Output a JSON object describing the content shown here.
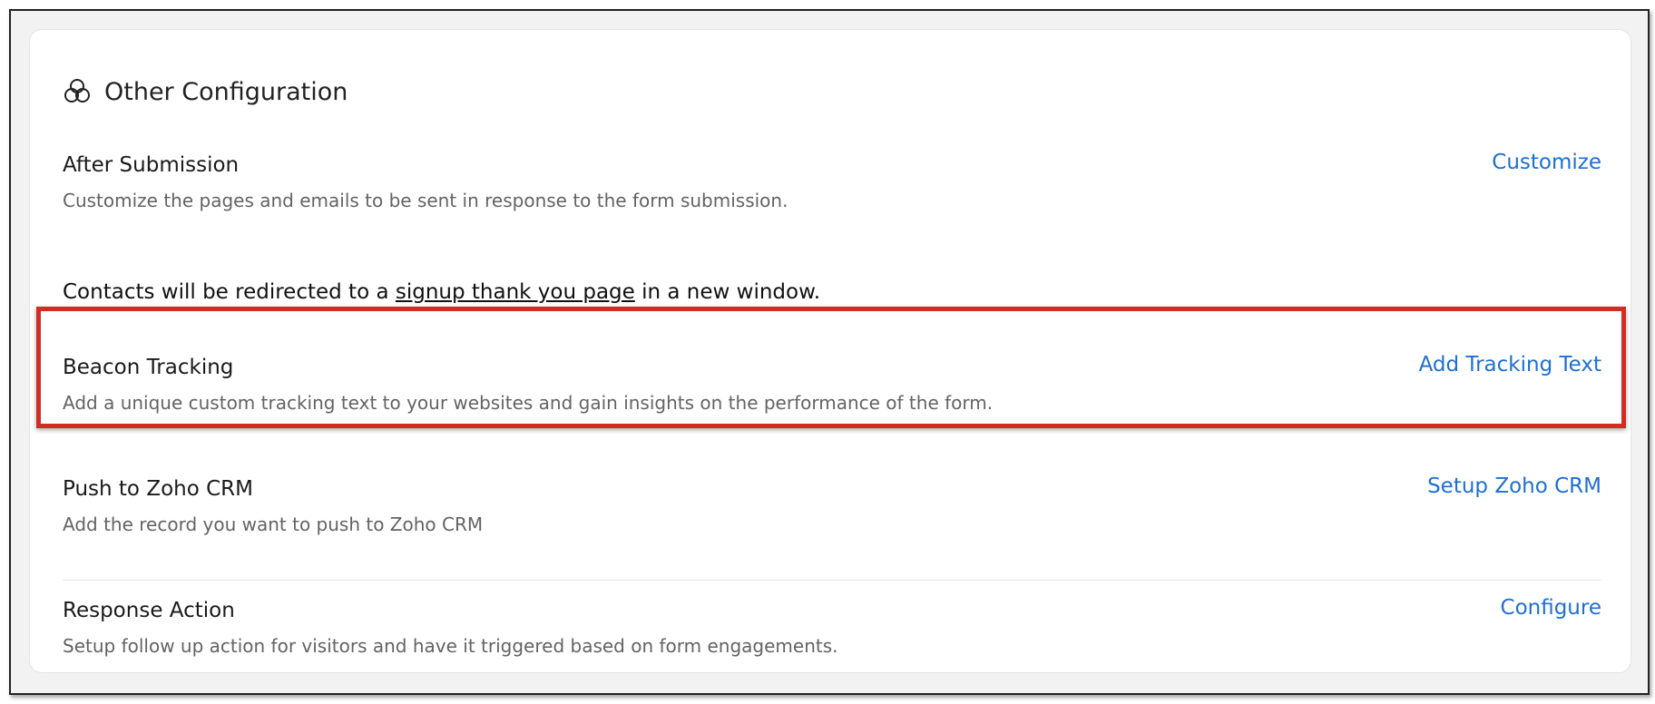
{
  "card": {
    "title": "Other Configuration",
    "icon": "circles-icon"
  },
  "sections": [
    {
      "title": "After Submission",
      "description": "Customize the pages and emails to be sent in response to the form submission.",
      "link": "Customize"
    },
    {
      "title": "Beacon Tracking",
      "description": "Add a unique custom tracking text to your websites and gain insights on the performance of the form.",
      "link": "Add Tracking Text"
    },
    {
      "title": "Push to Zoho CRM",
      "description": "Add the record you want to push to Zoho CRM",
      "link": "Setup Zoho CRM"
    },
    {
      "title": "Response Action",
      "description": "Setup follow up action for visitors and have it triggered based on form engagements.",
      "link": "Configure"
    }
  ],
  "redirect": {
    "prefix": "Contacts will be redirected to a ",
    "link": "signup thank you page",
    "suffix": " in a new window."
  },
  "colors": {
    "link": "#1f6fd1",
    "highlight": "#d22d22"
  }
}
